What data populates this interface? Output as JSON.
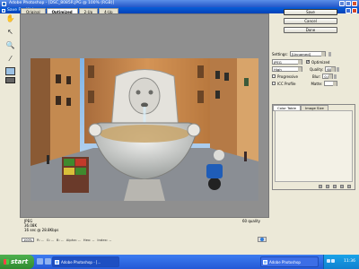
{
  "app": {
    "title": "Adobe Photoshop - [DSC_8085R.JPG @ 100% (RGB)]"
  },
  "dialog": {
    "title": "Save For Web",
    "tabs": [
      "Original",
      "Optimized",
      "2-Up",
      "4-Up"
    ],
    "active_tab": 1,
    "buttons": {
      "save": "Save",
      "cancel": "Cancel",
      "done": "Done"
    },
    "settings": {
      "label": "Settings:",
      "preset": "[Unnamed]",
      "format": "JPEG",
      "quality_level": "High",
      "optimized_label": "Optimized",
      "optimized_checked": true,
      "quality_label": "Quality:",
      "quality_value": "60",
      "progressive_label": "Progressive",
      "progressive_checked": false,
      "blur_label": "Blur:",
      "blur_value": "0.02",
      "icc_label": "ICC Profile",
      "icc_checked": false,
      "matte_label": "Matte:"
    },
    "color_panel": {
      "tabs": [
        "Color Table",
        "Image Size"
      ]
    },
    "info": {
      "format": "JPEG",
      "size": "36.08K",
      "time": "16 sec @ 28.8Kbps",
      "quality": "60 quality"
    },
    "bottom": {
      "zoom": "100%",
      "items": [
        "R: --",
        "G: --",
        "B: --",
        "Alpha: --",
        "Hex: --",
        "Index: --"
      ]
    }
  },
  "taskbar": {
    "start_label": "start",
    "buttons": [
      {
        "label": "Adobe Photoshop - [...",
        "active": true
      },
      {
        "label": "Adobe Photoshop",
        "active": false
      }
    ],
    "clock": "11:36"
  },
  "colors": {
    "titlebar": "#0a5fd8",
    "dialog_bg": "#ece9d8",
    "taskbar": "#2459d6",
    "start": "#3a9a3a"
  }
}
